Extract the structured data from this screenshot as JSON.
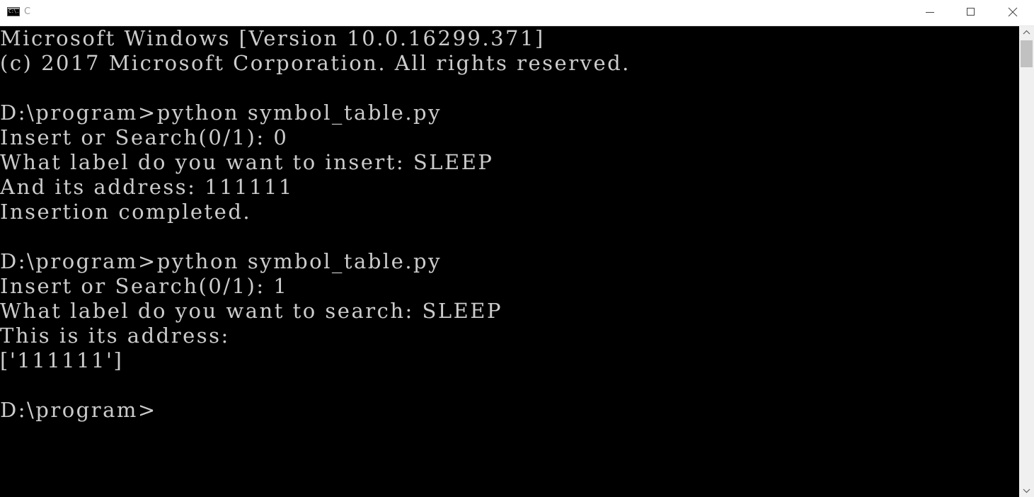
{
  "window": {
    "title": "C",
    "icon": "cmd-icon",
    "icon_text": "C:\\."
  },
  "controls": {
    "minimize": "minimize-icon",
    "maximize": "maximize-icon",
    "close": "close-icon"
  },
  "console": {
    "lines": [
      "Microsoft Windows [Version 10.0.16299.371]",
      "(c) 2017 Microsoft Corporation. All rights reserved.",
      "",
      "D:\\program>python symbol_table.py",
      "Insert or Search(0/1): 0",
      "What label do you want to insert: SLEEP",
      "And its address: 111111",
      "Insertion completed.",
      "",
      "D:\\program>python symbol_table.py",
      "Insert or Search(0/1): 1",
      "What label do you want to search: SLEEP",
      "This is its address:",
      "['111111']",
      "",
      "D:\\program>"
    ],
    "text_color": "#cccccc",
    "background": "#000000"
  },
  "scrollbar": {
    "up": "chevron-up-icon",
    "down": "chevron-down-icon"
  }
}
